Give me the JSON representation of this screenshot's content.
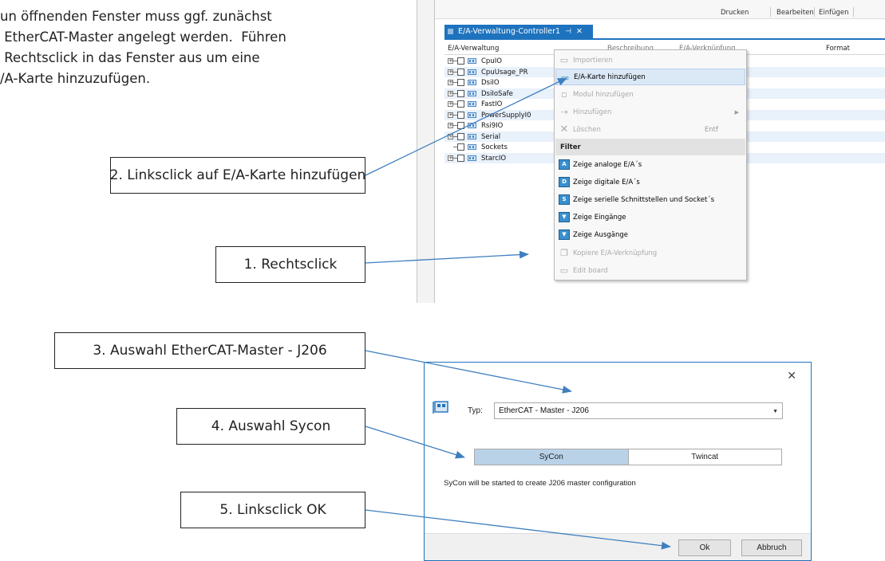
{
  "intro": {
    "text": "un öffnenden Fenster muss ggf. zunächst\n EtherCAT-Master angelegt werden.  Führen\n Rechtsclick in das Fenster aus um eine\n/A-Karte hinzuzufügen."
  },
  "callouts": {
    "step1": "1. Rechtsclick",
    "step2": "2. Linksclick auf E/A-Karte hinzufügen",
    "step3": "3. Auswahl EtherCAT-Master - J206",
    "step4": "4. Auswahl Sycon",
    "step5": "5. Linksclick OK"
  },
  "ribbon": {
    "print": "Drucken",
    "edit": "Bearbeiten",
    "insert": "Einfügen"
  },
  "doc_tab": {
    "title": "E/A-Verwaltung-Controller1",
    "pin": "⊣",
    "close": "✕"
  },
  "grid": {
    "col_name": "E/A-Verwaltung",
    "col_desc": "Beschreibung",
    "col_link": "E/A-Verknüpfung",
    "col_format": "Format"
  },
  "tree_items": [
    "CpuIO",
    "CpuUsage_PR",
    "DsiIO",
    "DsiIoSafe",
    "FastIO",
    "PowerSupplyI0",
    "Rsi9IO",
    "Serial",
    "Sockets",
    "StarcIO"
  ],
  "context_menu": {
    "import": "Importieren",
    "add_card": "E/A-Karte hinzufügen",
    "add_module": "Modul hinzufügen",
    "add": "Hinzufügen",
    "delete": "Löschen",
    "delete_key": "Entf",
    "filter": "Filter",
    "show_analog": "Zeige analoge E/A´s",
    "show_digital": "Zeige digitale E/A´s",
    "show_serial": "Zeige serielle Schnittstellen und Socket´s",
    "show_inputs": "Zeige Eingänge",
    "show_outputs": "Zeige Ausgänge",
    "copy_link": "Kopiere E/A-Verknüpfung",
    "edit_board": "Edit board"
  },
  "dialog": {
    "type_label": "Typ:",
    "type_value": "EtherCAT - Master - J206",
    "seg_sycon": "SyCon",
    "seg_twincat": "Twincat",
    "message": "SyCon will be started to create J206 master configuration",
    "ok": "Ok",
    "cancel": "Abbruch"
  },
  "colors": {
    "accent": "#1e73be",
    "arrow": "#3f7fbf",
    "selected_segment": "#b9d2e8"
  }
}
